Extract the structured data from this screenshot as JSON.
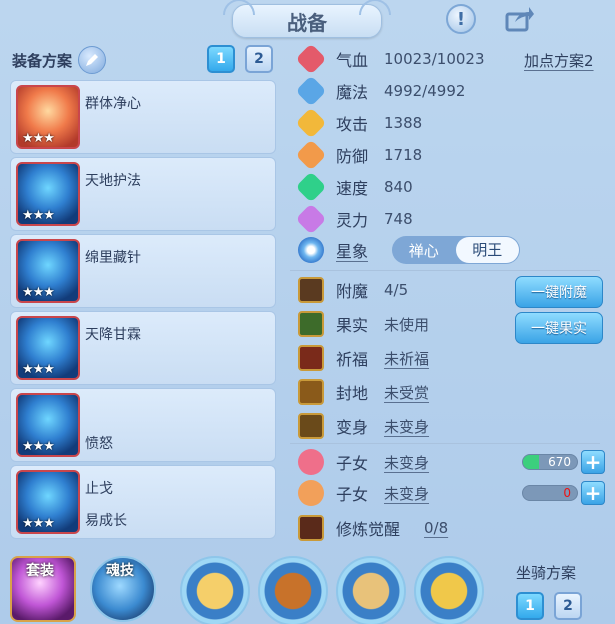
{
  "header": {
    "title": "战备"
  },
  "equipment": {
    "label": "装备方案",
    "slots": [
      "1",
      "2"
    ],
    "active_slot": "1",
    "items": [
      {
        "name": "群体净心",
        "stars": "★★★",
        "sub": ""
      },
      {
        "name": "天地护法",
        "stars": "★★★",
        "sub": ""
      },
      {
        "name": "绵里藏针",
        "stars": "★★★",
        "sub": ""
      },
      {
        "name": "天降甘霖",
        "stars": "★★★",
        "sub": ""
      },
      {
        "name": "",
        "stars": "★★★",
        "sub": "愤怒"
      },
      {
        "name": "止戈",
        "stars": "★★★",
        "sub": "易成长"
      }
    ]
  },
  "stats": {
    "plus_scheme": "加点方案2",
    "rows": [
      {
        "label": "气血",
        "value": "10023/10023",
        "color": "#e45a6a",
        "icon": "heart-icon"
      },
      {
        "label": "魔法",
        "value": "4992/4992",
        "color": "#5aa6e6",
        "icon": "mana-icon"
      },
      {
        "label": "攻击",
        "value": "1388",
        "color": "#f2b83a",
        "icon": "sword-icon"
      },
      {
        "label": "防御",
        "value": "1718",
        "color": "#f29a4a",
        "icon": "shield-icon"
      },
      {
        "label": "速度",
        "value": "840",
        "color": "#2fd08a",
        "icon": "speed-icon"
      },
      {
        "label": "灵力",
        "value": "748",
        "color": "#c87ae6",
        "icon": "spirit-icon"
      }
    ],
    "star_label": "星象",
    "star_options": [
      "禅心",
      "明王"
    ],
    "star_selected": "明王"
  },
  "extras": [
    {
      "label": "附魔",
      "value": "4/5",
      "underline": false,
      "icon": "enchant-icon"
    },
    {
      "label": "果实",
      "value": "未使用",
      "underline": false,
      "icon": "fruit-icon"
    },
    {
      "label": "祈福",
      "value": "未祈福",
      "underline": true,
      "icon": "pray-icon"
    },
    {
      "label": "封地",
      "value": "未受赏",
      "underline": true,
      "icon": "fief-icon"
    },
    {
      "label": "变身",
      "value": "未变身",
      "underline": true,
      "icon": "transform-icon"
    }
  ],
  "buttons": {
    "enchant_all": "一键附魔",
    "fruit_all": "一键果实"
  },
  "children": [
    {
      "label": "子女",
      "value": "未变身",
      "bar_value": "670",
      "bar_fill": 0.3,
      "icon": "child-female-icon"
    },
    {
      "label": "子女",
      "value": "未变身",
      "bar_value": "0",
      "bar_fill": 0,
      "icon": "child-male-icon"
    }
  ],
  "cultivation": {
    "label": "修炼觉醒",
    "value": "0/8"
  },
  "bottom": {
    "tag_set": "套装",
    "tag_soul": "魂技",
    "mount_label": "坐骑方案",
    "mount_slots": [
      "1",
      "2"
    ],
    "mount_active": "1"
  }
}
